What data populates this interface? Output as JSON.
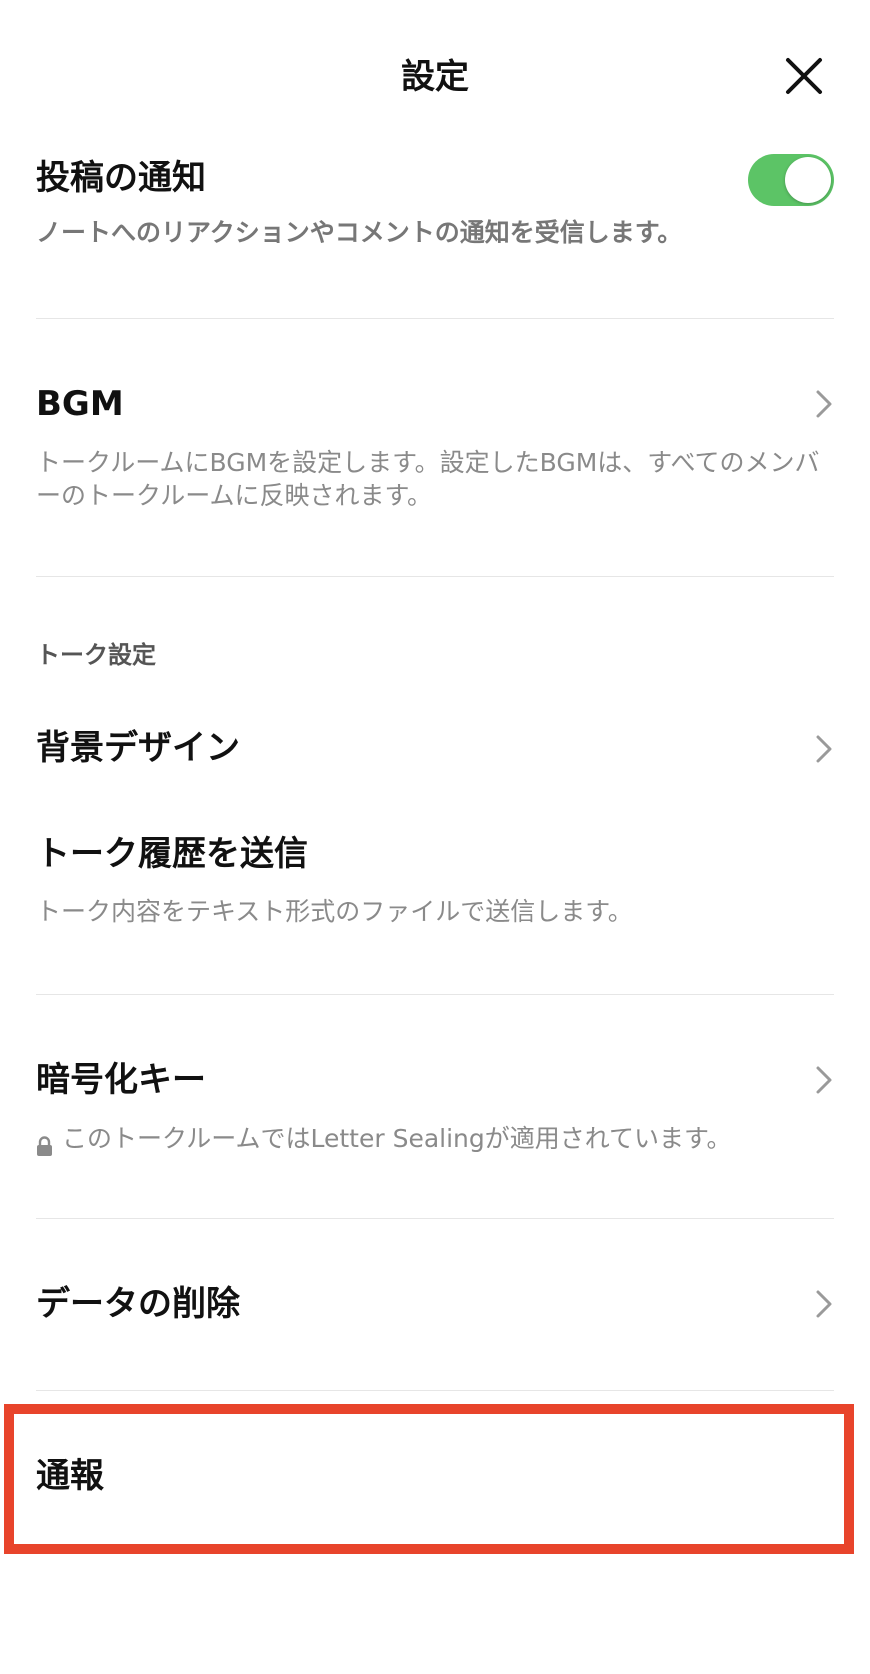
{
  "header": {
    "title": "設定",
    "close_icon": "close-icon"
  },
  "post_notification": {
    "title": "投稿の通知",
    "description": "ノートへのリアクションやコメントの通知を受信します。",
    "toggle_on": true
  },
  "bgm": {
    "title": "BGM",
    "description": "トークルームにBGMを設定します。設定したBGMは、すべてのメンバーのトークルームに反映されます。"
  },
  "talk_settings": {
    "section_label": "トーク設定",
    "background_design": {
      "title": "背景デザイン"
    },
    "send_history": {
      "title": "トーク履歴を送信",
      "description": "トーク内容をテキスト形式のファイルで送信します。"
    }
  },
  "encryption_key": {
    "title": "暗号化キー",
    "description": "このトークルームではLetter Sealingが適用されています。",
    "icon": "lock-icon"
  },
  "delete_data": {
    "title": "データの削除"
  },
  "report": {
    "title": "通報"
  },
  "colors": {
    "toggle_on": "#5cc466",
    "highlight": "#e8442b",
    "chevron": "#9a9a9a"
  }
}
